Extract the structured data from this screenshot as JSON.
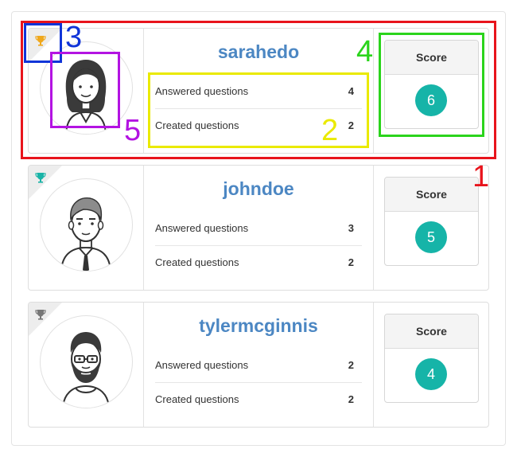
{
  "users": [
    {
      "username": "sarahedo",
      "answered_label": "Answered questions",
      "answered_value": "4",
      "created_label": "Created questions",
      "created_value": "2",
      "score_label": "Score",
      "score_value": "6",
      "trophy_color": "#f0a81c",
      "avatar_icon": "woman-avatar-icon"
    },
    {
      "username": "johndoe",
      "answered_label": "Answered questions",
      "answered_value": "3",
      "created_label": "Created questions",
      "created_value": "2",
      "score_label": "Score",
      "score_value": "5",
      "trophy_color": "#19b3a7",
      "avatar_icon": "man-tie-avatar-icon"
    },
    {
      "username": "tylermcginnis",
      "answered_label": "Answered questions",
      "answered_value": "2",
      "created_label": "Created questions",
      "created_value": "2",
      "score_label": "Score",
      "score_value": "4",
      "trophy_color": "#777777",
      "avatar_icon": "bearded-man-avatar-icon"
    }
  ],
  "annotations": [
    {
      "label": "1",
      "color": "#e8141c"
    },
    {
      "label": "2",
      "color": "#eaea00"
    },
    {
      "label": "3",
      "color": "#1034d8"
    },
    {
      "label": "4",
      "color": "#2bd41c"
    },
    {
      "label": "5",
      "color": "#b313e2"
    }
  ],
  "colors": {
    "username": "#4c87c3",
    "score_circle": "#16b4a8"
  }
}
